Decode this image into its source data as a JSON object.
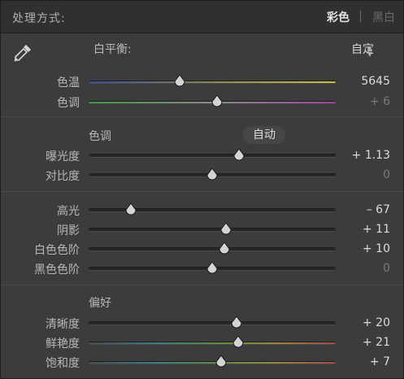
{
  "header": {
    "title": "处理方式:",
    "treatments": {
      "color": "彩色",
      "bw": "黑白"
    }
  },
  "white_balance": {
    "label": "白平衡:",
    "value": "自定",
    "caret": "◆"
  },
  "tone_section": {
    "label": "色调",
    "auto": "自动"
  },
  "presence_section": {
    "label": "偏好"
  },
  "sliders": {
    "temp": {
      "label": "色温",
      "value": "5645",
      "pos": 0.37,
      "gradient": "linear-gradient(90deg,#3a4aa0,#8a8a50,#c8c040)",
      "muted": false
    },
    "tint": {
      "label": "色调",
      "value": "+ 6",
      "pos": 0.52,
      "gradient": "linear-gradient(90deg,#3a9a3a,#8a8a8a,#a040a8)",
      "muted": true
    },
    "exposure": {
      "label": "曝光度",
      "value": "+ 1.13",
      "pos": 0.61,
      "gradient": "",
      "muted": false
    },
    "contrast": {
      "label": "对比度",
      "value": "0",
      "pos": 0.5,
      "gradient": "",
      "muted": true
    },
    "highlights": {
      "label": "高光",
      "value": "– 67",
      "pos": 0.17,
      "gradient": "",
      "muted": false
    },
    "shadows": {
      "label": "阴影",
      "value": "+ 11",
      "pos": 0.555,
      "gradient": "",
      "muted": false
    },
    "whites": {
      "label": "白色色阶",
      "value": "+ 10",
      "pos": 0.55,
      "gradient": "",
      "muted": false
    },
    "blacks": {
      "label": "黑色色阶",
      "value": "0",
      "pos": 0.5,
      "gradient": "",
      "muted": true
    },
    "clarity": {
      "label": "清晰度",
      "value": "+ 20",
      "pos": 0.6,
      "gradient": "",
      "muted": false
    },
    "vibrance": {
      "label": "鲜艳度",
      "value": "+ 21",
      "pos": 0.605,
      "gradient": "linear-gradient(90deg,#4a4a4a,#3a7a8a,#5a8a4a,#9a8a3a,#a04a4a)",
      "muted": false
    },
    "saturation": {
      "label": "饱和度",
      "value": "+ 7",
      "pos": 0.535,
      "gradient": "linear-gradient(90deg,#4a4a4a,#3a7a8a,#5a8a4a,#9a8a3a,#a04a4a)",
      "muted": false
    }
  },
  "colors": {
    "panel": "#3c3c3c",
    "header": "#303030",
    "text": "#b8b8b8",
    "value": "#dcdcdc",
    "muted": "#7a7a7a"
  }
}
